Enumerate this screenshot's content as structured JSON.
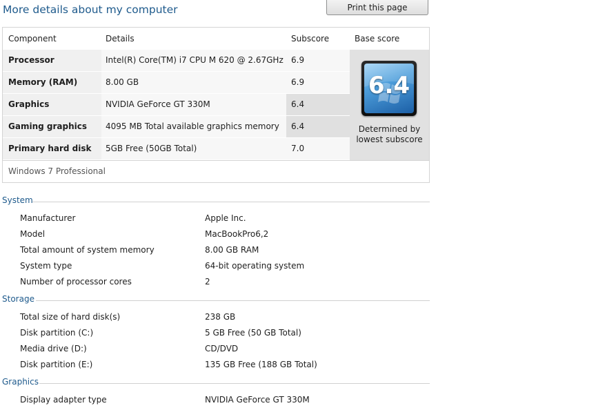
{
  "page": {
    "title": "More details about my computer",
    "print_button": "Print this page"
  },
  "score_table": {
    "headers": [
      "Component",
      "Details",
      "Subscore",
      "Base score"
    ],
    "rows": [
      {
        "component": "Processor",
        "details": "Intel(R) Core(TM) i7 CPU M 620 @ 2.67GHz",
        "subscore": "6.9"
      },
      {
        "component": "Memory (RAM)",
        "details": "8.00 GB",
        "subscore": "6.9"
      },
      {
        "component": "Graphics",
        "details": "NVIDIA GeForce GT 330M",
        "subscore": "6.4"
      },
      {
        "component": "Gaming graphics",
        "details": "4095 MB Total available graphics memory",
        "subscore": "6.4"
      },
      {
        "component": "Primary hard disk",
        "details": "5GB Free (50GB Total)",
        "subscore": "7.0"
      }
    ],
    "base_score": "6.4",
    "base_caption_line1": "Determined by",
    "base_caption_line2": "lowest subscore",
    "edition": "Windows 7 Professional"
  },
  "sections": {
    "system": {
      "heading": "System",
      "items": [
        {
          "label": "Manufacturer",
          "value": "Apple Inc."
        },
        {
          "label": "Model",
          "value": "MacBookPro6,2"
        },
        {
          "label": "Total amount of system memory",
          "value": "8.00 GB RAM"
        },
        {
          "label": "System type",
          "value": "64-bit operating system"
        },
        {
          "label": "Number of processor cores",
          "value": "2"
        }
      ]
    },
    "storage": {
      "heading": "Storage",
      "items": [
        {
          "label": "Total size of hard disk(s)",
          "value": "238 GB"
        },
        {
          "label": "Disk partition (C:)",
          "value": "5 GB Free (50 GB Total)"
        },
        {
          "label": "Media drive (D:)",
          "value": "CD/DVD"
        },
        {
          "label": "Disk partition (E:)",
          "value": "135 GB Free (188 GB Total)"
        }
      ]
    },
    "graphics": {
      "heading": "Graphics",
      "items": [
        {
          "label": "Display adapter type",
          "value": "NVIDIA GeForce GT 330M"
        }
      ]
    }
  },
  "colors": {
    "accent": "#1e5a8c",
    "header_bg": "#f0f0f0",
    "lowest_subscore_bg": "#e0e0e0",
    "base_score_bg": "#e1e1e1"
  }
}
